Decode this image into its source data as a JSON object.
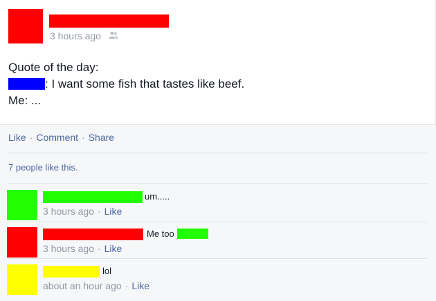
{
  "post": {
    "time": "3 hours ago",
    "audience_icon": "friends-icon",
    "lines": [
      "Quote of the day:",
      ": I want some fish that tastes like beef.",
      "Me: ..."
    ]
  },
  "actions": {
    "like": "Like",
    "comment": "Comment",
    "share": "Share",
    "separator": "·"
  },
  "likes_text": "7 people like this.",
  "comments": [
    {
      "text": "um.....",
      "time": "3 hours ago",
      "like": "Like",
      "avatar_color": "#22ff00"
    },
    {
      "text": "Me too",
      "time": "3 hours ago",
      "like": "Like",
      "avatar_color": "#ff0000"
    },
    {
      "text": "lol",
      "time": "about an hour ago",
      "like": "Like",
      "avatar_color": "#ffff00"
    }
  ],
  "colors": {
    "red": "#ff0000",
    "blue": "#0000ff",
    "green": "#22ff00",
    "yellow": "#ffff00",
    "link": "#4b67a1",
    "meta": "#9197a3"
  }
}
